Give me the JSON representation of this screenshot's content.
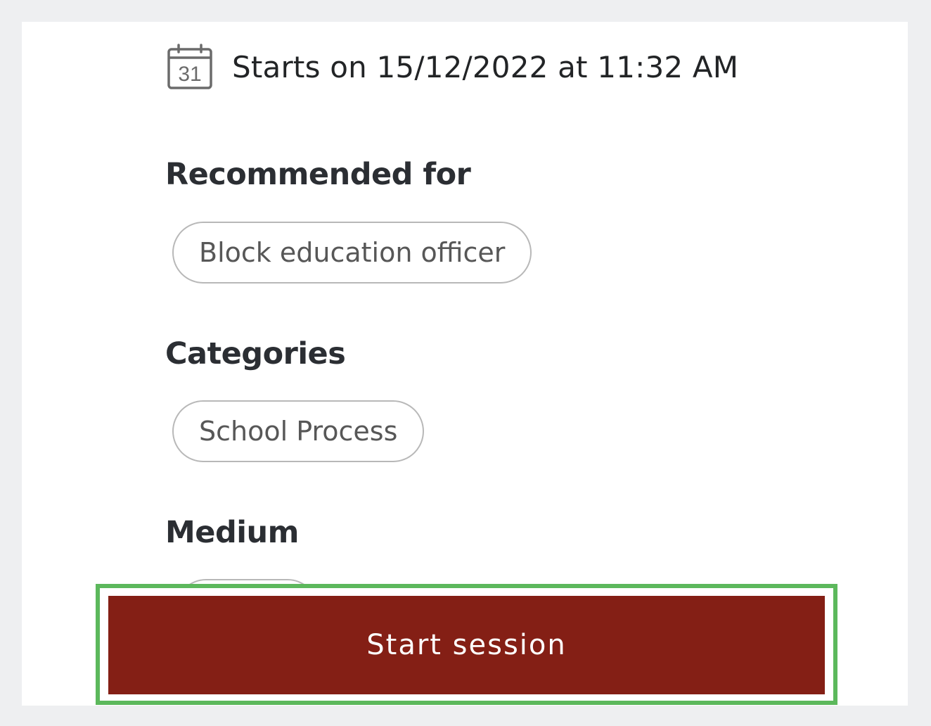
{
  "session": {
    "start_label": "Starts on 15/12/2022 at 11:32 AM",
    "calendar_icon": "calendar-icon",
    "calendar_day": "31"
  },
  "recommended_for": {
    "title": "Recommended for",
    "chips": [
      "Block education officer"
    ]
  },
  "categories": {
    "title": "Categories",
    "chips": [
      "School Process"
    ]
  },
  "medium": {
    "title": "Medium"
  },
  "actions": {
    "start_session_label": "Start session",
    "button_color": "#841f15",
    "highlight_color": "#5cb85c"
  }
}
